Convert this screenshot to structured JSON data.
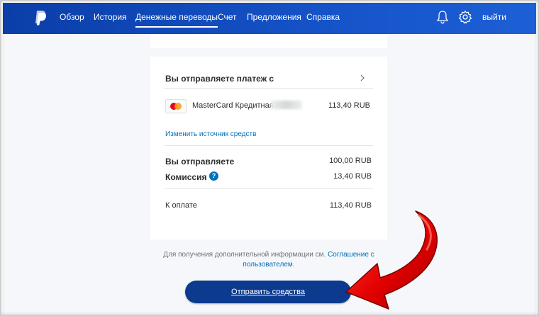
{
  "nav": {
    "items": [
      {
        "label": "Обзор"
      },
      {
        "label": "История"
      },
      {
        "label": "Денежные переводы"
      },
      {
        "label": "Счет"
      },
      {
        "label": "Предложения"
      },
      {
        "label": "Справка"
      }
    ],
    "logout": "выйти",
    "icons": [
      "paypal-logo",
      "bell-icon",
      "gear-icon"
    ]
  },
  "payment": {
    "source_heading": "Вы отправляете платеж с",
    "card_name": "MasterCard Кредитная",
    "card_amount": "113,40 RUB",
    "change_source": "Изменить источник средств",
    "send_label": "Вы отправляете",
    "send_amount": "100,00 RUB",
    "fee_label": "Комиссия",
    "fee_amount": "13,40 RUB",
    "fee_help": "?",
    "total_label": "К оплате",
    "total_amount": "113,40 RUB"
  },
  "footer": {
    "note_prefix": "Для получения дополнительной информации см. ",
    "note_link": "Соглашение с пользователем",
    "note_suffix": ".",
    "send_button": "Отправить средства"
  },
  "colors": {
    "nav_bg": "#1553c8",
    "button_bg": "#0b3a8e",
    "link": "#0070ba",
    "arrow": "#e30000"
  }
}
